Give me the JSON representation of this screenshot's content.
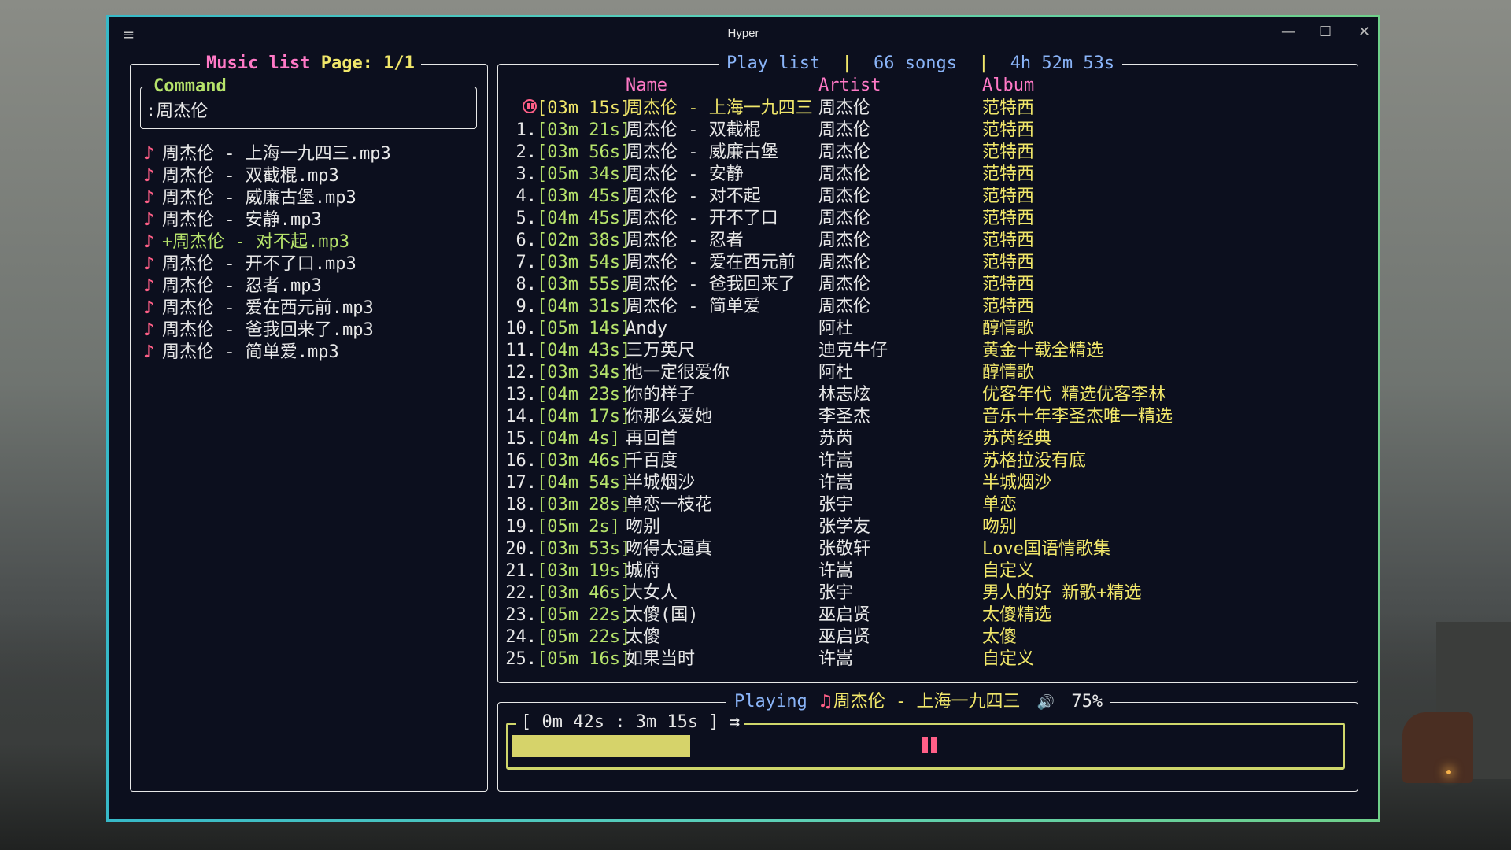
{
  "window": {
    "title": "Hyper",
    "menu_icon": "≡",
    "minimize_icon": "—",
    "maximize_icon": "☐",
    "close_icon": "✕"
  },
  "music_list": {
    "title": "Music list",
    "page_label": "Page: 1/1",
    "command_title": "Command",
    "command_value": ":周杰伦",
    "note_icon": "♪",
    "files": [
      "周杰伦 - 上海一九四三.mp3",
      "周杰伦 - 双截棍.mp3",
      "周杰伦 - 威廉古堡.mp3",
      "周杰伦 - 安静.mp3",
      "+周杰伦 - 对不起.mp3",
      "周杰伦 - 开不了口.mp3",
      "周杰伦 - 忍者.mp3",
      "周杰伦 - 爱在西元前.mp3",
      "周杰伦 - 爸我回来了.mp3",
      "周杰伦 - 简单爱.mp3"
    ],
    "selected_index": 4
  },
  "play_list": {
    "title": "Play list",
    "sep": "|",
    "songs_count": "66 songs",
    "total_duration": "4h 52m 53s",
    "headers": {
      "name": "Name",
      "artist": "Artist",
      "album": "Album"
    },
    "rows": [
      {
        "num": "",
        "dur": "[03m 15s]",
        "name": "周杰伦 - 上海一九四三",
        "artist": "周杰伦",
        "album": "范特西"
      },
      {
        "num": "1.",
        "dur": "[03m 21s]",
        "name": "周杰伦 - 双截棍",
        "artist": "周杰伦",
        "album": "范特西"
      },
      {
        "num": "2.",
        "dur": "[03m 56s]",
        "name": "周杰伦 - 威廉古堡",
        "artist": "周杰伦",
        "album": "范特西"
      },
      {
        "num": "3.",
        "dur": "[05m 34s]",
        "name": "周杰伦 - 安静",
        "artist": "周杰伦",
        "album": "范特西"
      },
      {
        "num": "4.",
        "dur": "[03m 45s]",
        "name": "周杰伦 - 对不起",
        "artist": "周杰伦",
        "album": "范特西"
      },
      {
        "num": "5.",
        "dur": "[04m 45s]",
        "name": "周杰伦 - 开不了口",
        "artist": "周杰伦",
        "album": "范特西"
      },
      {
        "num": "6.",
        "dur": "[02m 38s]",
        "name": "周杰伦 - 忍者",
        "artist": "周杰伦",
        "album": "范特西"
      },
      {
        "num": "7.",
        "dur": "[03m 54s]",
        "name": "周杰伦 - 爱在西元前",
        "artist": "周杰伦",
        "album": "范特西"
      },
      {
        "num": "8.",
        "dur": "[03m 55s]",
        "name": "周杰伦 - 爸我回来了",
        "artist": "周杰伦",
        "album": "范特西"
      },
      {
        "num": "9.",
        "dur": "[04m 31s]",
        "name": "周杰伦 - 简单爱",
        "artist": "周杰伦",
        "album": "范特西"
      },
      {
        "num": "10.",
        "dur": "[05m 14s]",
        "name": "Andy",
        "artist": "阿杜",
        "album": "醇情歌"
      },
      {
        "num": "11.",
        "dur": "[04m 43s]",
        "name": "三万英尺",
        "artist": "迪克牛仔",
        "album": "黄金十载全精选"
      },
      {
        "num": "12.",
        "dur": "[03m 34s]",
        "name": "他一定很爱你",
        "artist": "阿杜",
        "album": "醇情歌"
      },
      {
        "num": "13.",
        "dur": "[04m 23s]",
        "name": "你的样子",
        "artist": "林志炫",
        "album": "优客年代 精选优客李林"
      },
      {
        "num": "14.",
        "dur": "[04m 17s]",
        "name": "你那么爱她",
        "artist": "李圣杰",
        "album": "音乐十年李圣杰唯一精选"
      },
      {
        "num": "15.",
        "dur": "[04m  4s]",
        "name": "再回首",
        "artist": "苏芮",
        "album": "苏芮经典"
      },
      {
        "num": "16.",
        "dur": "[03m 46s]",
        "name": "千百度",
        "artist": "许嵩",
        "album": "苏格拉没有底"
      },
      {
        "num": "17.",
        "dur": "[04m 54s]",
        "name": "半城烟沙",
        "artist": "许嵩",
        "album": "半城烟沙"
      },
      {
        "num": "18.",
        "dur": "[03m 28s]",
        "name": "单恋一枝花",
        "artist": "张宇",
        "album": "单恋"
      },
      {
        "num": "19.",
        "dur": "[05m  2s]",
        "name": "吻别",
        "artist": "张学友",
        "album": "吻别"
      },
      {
        "num": "20.",
        "dur": "[03m 53s]",
        "name": "吻得太逼真",
        "artist": "张敬轩",
        "album": "Love国语情歌集"
      },
      {
        "num": "21.",
        "dur": "[03m 19s]",
        "name": "城府",
        "artist": "许嵩",
        "album": "自定义"
      },
      {
        "num": "22.",
        "dur": "[03m 46s]",
        "name": "大女人",
        "artist": "张宇",
        "album": "男人的好 新歌+精选"
      },
      {
        "num": "23.",
        "dur": "[05m 22s]",
        "name": "太傻(国)",
        "artist": "巫启贤",
        "album": "太傻精选"
      },
      {
        "num": "24.",
        "dur": "[05m 22s]",
        "name": "太傻",
        "artist": "巫启贤",
        "album": "太傻"
      },
      {
        "num": "25.",
        "dur": "[05m 16s]",
        "name": "如果当时",
        "artist": "许嵩",
        "album": "自定义"
      }
    ]
  },
  "playing": {
    "label": "Playing",
    "note_icon": "♫",
    "track": "周杰伦 - 上海一九四三",
    "volume_icon": "🔊",
    "volume": "75%",
    "time_display": "[ 0m 42s : 3m 15s ] ⇉",
    "progress": 0.215,
    "state": "paused"
  },
  "colors": {
    "accent_pink": "#ff79c6",
    "accent_yellow": "#f1e76a",
    "accent_green": "#b6e36b",
    "accent_blue": "#8ab4f8",
    "pause_red": "#ff5f87"
  }
}
